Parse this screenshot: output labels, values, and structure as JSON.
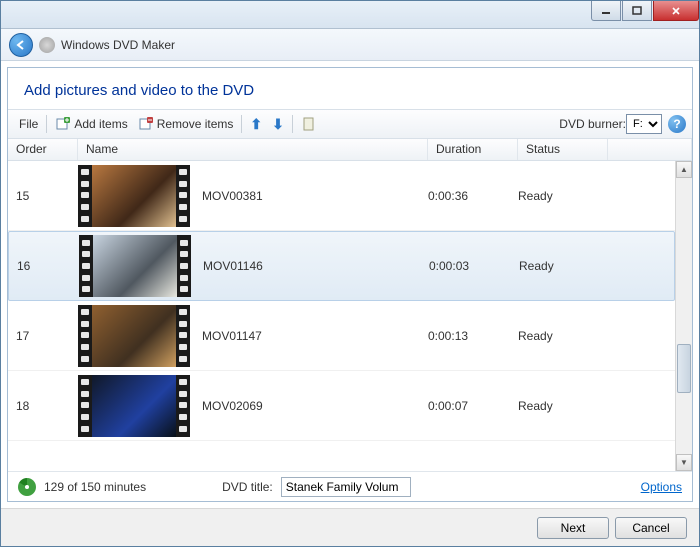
{
  "window": {
    "app_title": "Windows DVD Maker"
  },
  "heading": "Add pictures and video to the DVD",
  "toolbar": {
    "file": "File",
    "add_items": "Add items",
    "remove_items": "Remove items",
    "dvd_burner_label": "DVD burner:",
    "dvd_burner_value": "F:"
  },
  "columns": {
    "order": "Order",
    "name": "Name",
    "duration": "Duration",
    "status": "Status"
  },
  "items": [
    {
      "order": "15",
      "name": "MOV00381",
      "duration": "0:00:36",
      "status": "Ready",
      "selected": false,
      "palette": [
        "#b87840",
        "#402818",
        "#e0c090"
      ]
    },
    {
      "order": "16",
      "name": "MOV01146",
      "duration": "0:00:03",
      "status": "Ready",
      "selected": true,
      "palette": [
        "#c8d4e0",
        "#505860",
        "#e8e8e0"
      ]
    },
    {
      "order": "17",
      "name": "MOV01147",
      "duration": "0:00:13",
      "status": "Ready",
      "selected": false,
      "palette": [
        "#906030",
        "#403020",
        "#d0a060"
      ]
    },
    {
      "order": "18",
      "name": "MOV02069",
      "duration": "0:00:07",
      "status": "Ready",
      "selected": false,
      "palette": [
        "#101828",
        "#2040a0",
        "#081018"
      ]
    }
  ],
  "footer": {
    "minutes_text": "129 of 150 minutes",
    "dvd_title_label": "DVD title:",
    "dvd_title_value": "Stanek Family Volum",
    "options": "Options"
  },
  "buttons": {
    "next": "Next",
    "cancel": "Cancel"
  }
}
